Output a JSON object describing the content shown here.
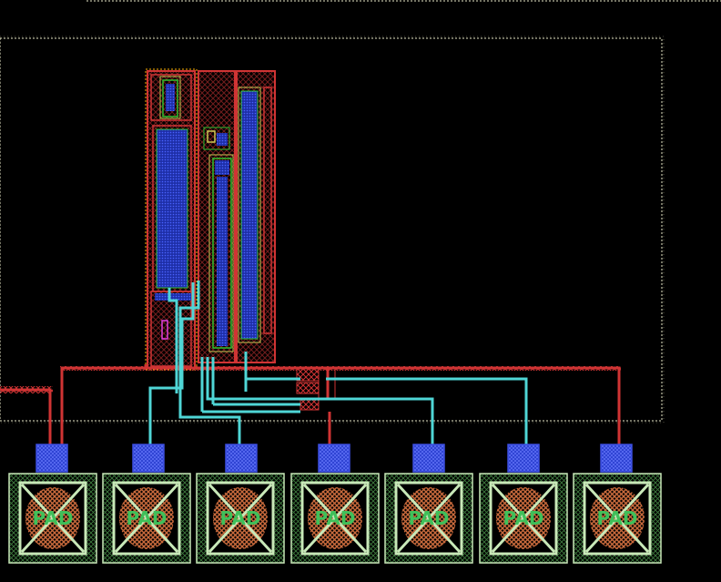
{
  "view": {
    "background": "#000000",
    "colors": {
      "boundary": "#e8e8c8",
      "metal1": "#d03434",
      "metal2": "#4fd6d6",
      "poly": "#d83030",
      "diffusion_outline": "#2fbf2f",
      "nwell_outline": "#c9c955",
      "implant_outline": "#ffb000",
      "active_fill": "#2a3fd0",
      "pad_frame": "#c8e8b8",
      "pad_blob": "#c96a3c",
      "pad_text": "#3fc05a",
      "via": "#3a4de0",
      "magenta": "#e040e0"
    }
  },
  "pads": {
    "label": "PAD",
    "items": [
      {
        "id": "pad-1"
      },
      {
        "id": "pad-2"
      },
      {
        "id": "pad-3"
      },
      {
        "id": "pad-4"
      },
      {
        "id": "pad-5"
      },
      {
        "id": "pad-6"
      },
      {
        "id": "pad-7"
      }
    ]
  },
  "transistors": [
    {
      "id": "device-left"
    },
    {
      "id": "device-middle"
    },
    {
      "id": "device-right"
    }
  ]
}
